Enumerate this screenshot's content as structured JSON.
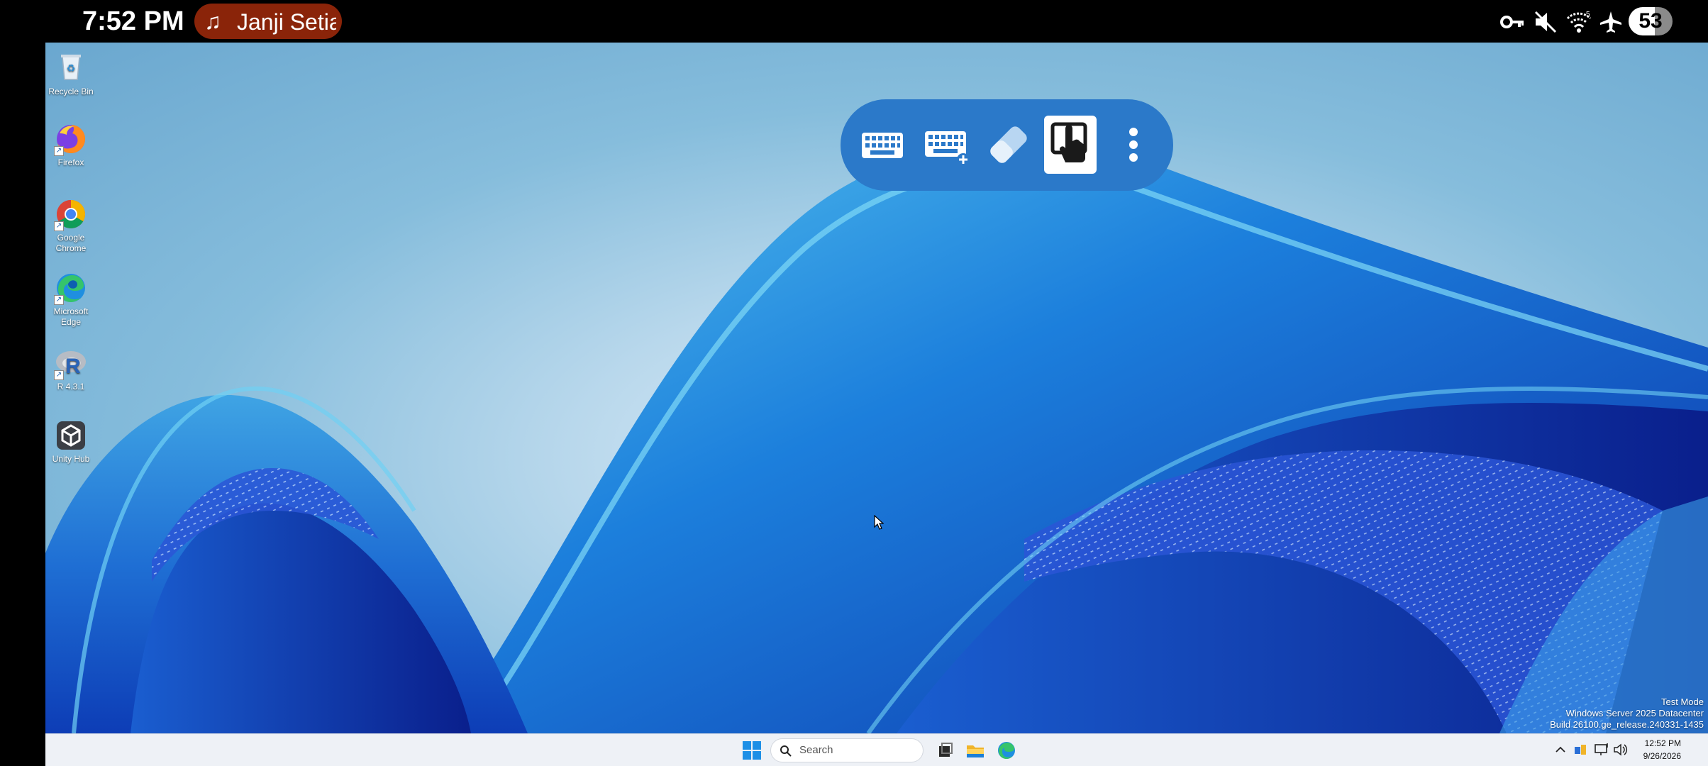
{
  "status_bar": {
    "time": "7:52 PM",
    "media_title": "Janji Setia",
    "battery": "53",
    "icons": [
      "vpn-key-icon",
      "mute-icon",
      "wifi-icon",
      "airplane-mode-icon",
      "battery-icon"
    ]
  },
  "desktop_icons": [
    {
      "label": "Recycle Bin",
      "icon": "recycle-bin-icon"
    },
    {
      "label": "Firefox",
      "icon": "firefox-icon"
    },
    {
      "label": "Google Chrome",
      "icon": "chrome-icon"
    },
    {
      "label": "Microsoft Edge",
      "icon": "edge-icon"
    },
    {
      "label": "R 4.3.1",
      "icon": "r-icon"
    },
    {
      "label": "Unity Hub",
      "icon": "unity-hub-icon"
    }
  ],
  "floating_toolbar": {
    "buttons": [
      "keyboard-icon",
      "keyboard-add-icon",
      "eraser-icon",
      "touch-mode-icon",
      "more-options-icon"
    ],
    "active": "touch-mode-icon"
  },
  "watermark": {
    "line1": "Test Mode",
    "line2": "Windows Server 2025 Datacenter",
    "line3": "Build 26100.ge_release.240331-1435"
  },
  "taskbar": {
    "search_placeholder": "Search",
    "apps": [
      "task-view-icon",
      "file-explorer-icon",
      "edge-icon"
    ],
    "tray": [
      "chevron-up-icon",
      "network-tray-icon",
      "display-icon",
      "volume-icon",
      "notification-icon"
    ],
    "clock_time": "12:52 PM",
    "clock_date": "9/26/2026"
  },
  "colors": {
    "toolbar": "#2b79c9",
    "media_chip": "#8a2409",
    "taskbar": "#eef1f6"
  }
}
